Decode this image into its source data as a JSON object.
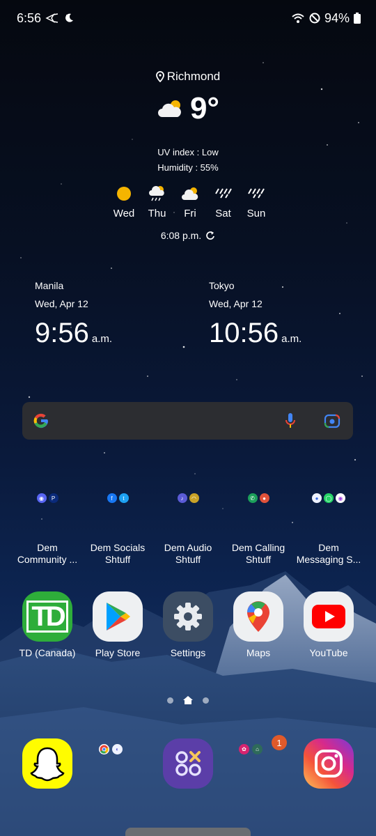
{
  "status_bar": {
    "time": "6:56",
    "battery": "94%"
  },
  "weather": {
    "location": "Richmond",
    "temperature": "9°",
    "uv_index": "UV index : Low",
    "humidity": "Humidity : 55%",
    "forecast": [
      {
        "day": "Wed",
        "icon": "sun-icon"
      },
      {
        "day": "Thu",
        "icon": "rain-cloud-sun-icon"
      },
      {
        "day": "Fri",
        "icon": "cloud-sun-icon"
      },
      {
        "day": "Sat",
        "icon": "rain-icon"
      },
      {
        "day": "Sun",
        "icon": "rain-icon"
      }
    ],
    "updated_time": "6:08 p.m."
  },
  "clocks": [
    {
      "city": "Manila",
      "date": "Wed, Apr 12",
      "time": "9:56",
      "ampm": "a.m."
    },
    {
      "city": "Tokyo",
      "date": "Wed, Apr 12",
      "time": "10:56",
      "ampm": "a.m."
    }
  ],
  "folders": [
    {
      "line1": "Dem",
      "line2": "Community ...",
      "icons": [
        "discord-icon",
        "playstation-icon"
      ]
    },
    {
      "line1": "Dem Socials",
      "line2": "Shtuff",
      "icons": [
        "facebook-icon",
        "twitter-icon"
      ]
    },
    {
      "line1": "Dem Audio",
      "line2": "Shtuff",
      "icons": [
        "music-icon",
        "headphones-icon"
      ]
    },
    {
      "line1": "Dem Calling",
      "line2": "Shtuff",
      "icons": [
        "phone-icon",
        "contacts-icon"
      ]
    },
    {
      "line1": "Dem",
      "line2": "Messaging S...",
      "icons": [
        "messages-icon",
        "whatsapp-icon",
        "messenger-icon"
      ]
    }
  ],
  "apps": [
    {
      "label": "TD (Canada)",
      "icon": "td-bank-icon",
      "icon_text": "TD"
    },
    {
      "label": "Play Store",
      "icon": "play-store-icon"
    },
    {
      "label": "Settings",
      "icon": "gear-icon"
    },
    {
      "label": "Maps",
      "icon": "maps-icon"
    },
    {
      "label": "YouTube",
      "icon": "youtube-icon"
    }
  ],
  "dock": {
    "items": [
      "snapchat-icon",
      "browser-folder-icon",
      "games-icon",
      "tools-folder-icon",
      "instagram-icon"
    ],
    "badge_count": "1"
  },
  "colors": {
    "search_bg": "#2c2d31",
    "td_green": "#2ead3a",
    "youtube_red": "#f00",
    "badge": "#e05a2a"
  }
}
